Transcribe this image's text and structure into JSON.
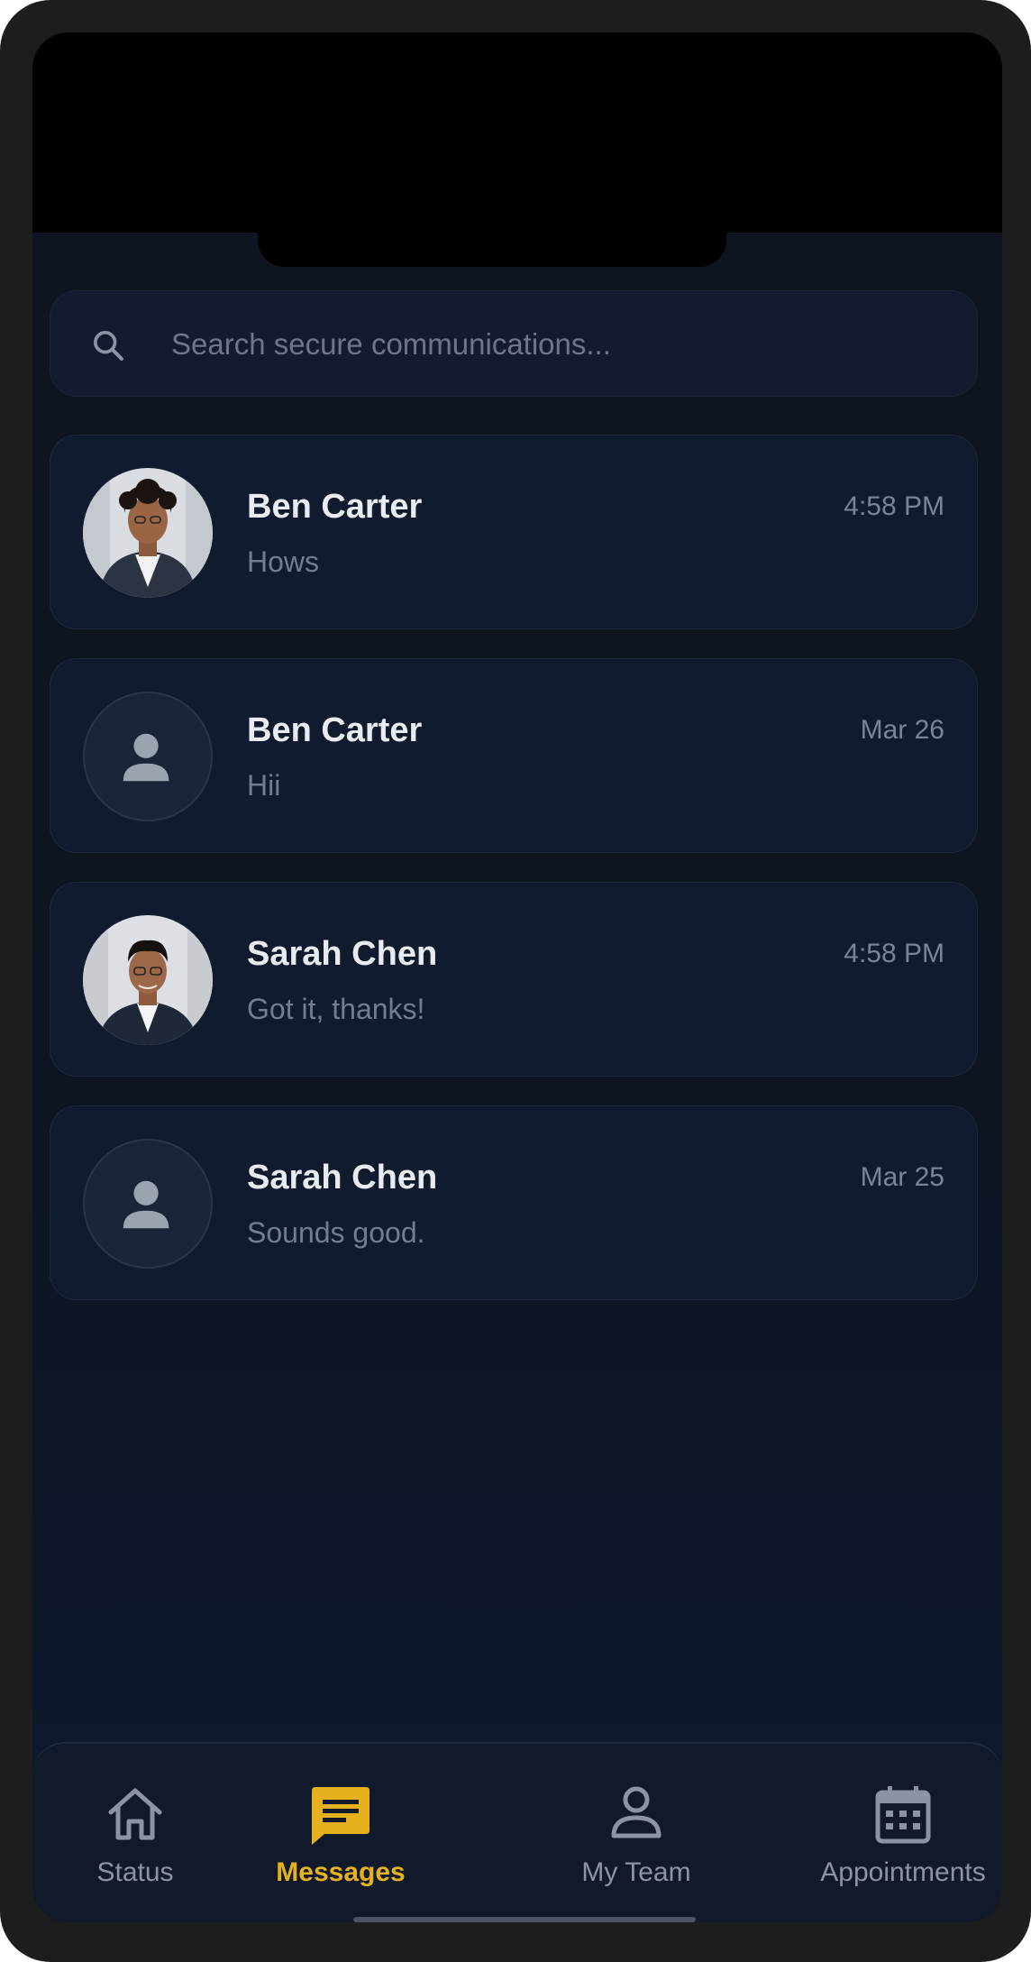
{
  "search": {
    "placeholder": "Search secure communications..."
  },
  "conversations": [
    {
      "name": "Ben Carter",
      "time": "4:58 PM",
      "preview": "Hows",
      "avatar": "photo"
    },
    {
      "name": "Ben Carter",
      "time": "Mar 26",
      "preview": "Hii",
      "avatar": "placeholder"
    },
    {
      "name": "Sarah Chen",
      "time": "4:58 PM",
      "preview": "Got it, thanks!",
      "avatar": "photo"
    },
    {
      "name": "Sarah Chen",
      "time": "Mar 25",
      "preview": "Sounds good.",
      "avatar": "placeholder"
    }
  ],
  "nav": {
    "items": [
      {
        "label": "Status",
        "icon": "home-icon",
        "active": false
      },
      {
        "label": "Messages",
        "icon": "message-icon",
        "active": true
      },
      {
        "label": "My Team",
        "icon": "person-icon",
        "active": false
      },
      {
        "label": "Appointments",
        "icon": "calendar-icon",
        "active": false
      }
    ]
  },
  "colors": {
    "accent": "#e5b21e",
    "card": "#111b2e",
    "background": "#0d1521"
  }
}
